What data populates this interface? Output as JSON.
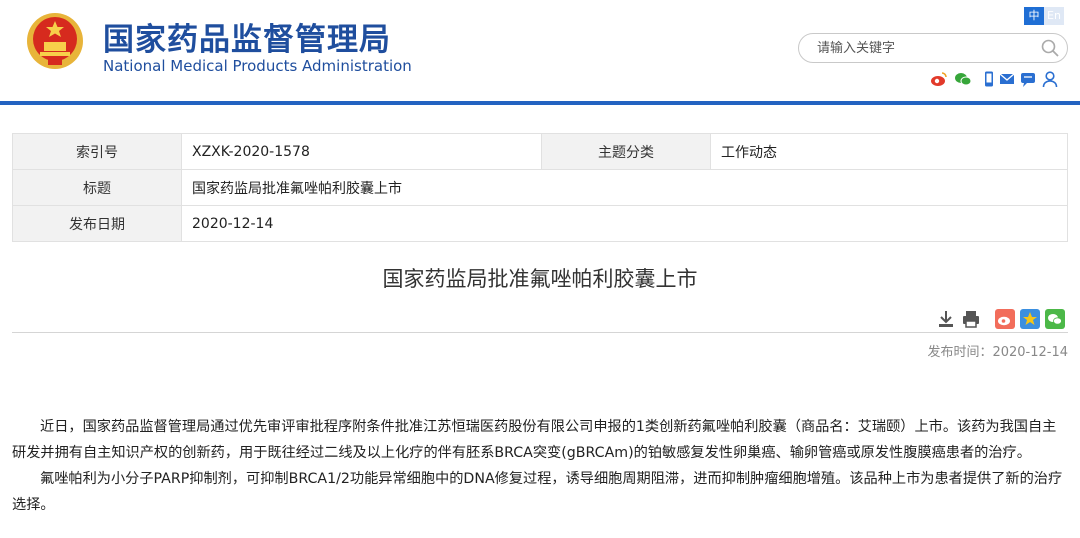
{
  "header": {
    "title_cn": "国家药品监督管理局",
    "title_en": "National Medical Products Administration",
    "lang_cn": "中",
    "lang_en": "En",
    "search_placeholder": "请输入关键字",
    "brand_color": "#1f4e9e",
    "accent_color": "#2363c1",
    "icons": [
      "weibo-icon",
      "wechat-icon",
      "mobile-icon",
      "mail-icon",
      "message-icon",
      "user-icon"
    ]
  },
  "meta": {
    "rows": [
      {
        "label1": "索引号",
        "value1": "XZXK-2020-1578",
        "label2": "主题分类",
        "value2": "工作动态"
      },
      {
        "label1": "标题",
        "value1": "国家药监局批准氟唑帕利胶囊上市"
      },
      {
        "label1": "发布日期",
        "value1": "2020-12-14"
      }
    ]
  },
  "article": {
    "title": "国家药监局批准氟唑帕利胶囊上市",
    "pubdate": "发布时间：2020-12-14",
    "tools": [
      "download-icon",
      "print-icon",
      "weibo-share-icon",
      "qzone-share-icon",
      "wechat-share-icon"
    ],
    "paragraphs": [
      "近日，国家药品监督管理局通过优先审评审批程序附条件批准江苏恒瑞医药股份有限公司申报的1类创新药氟唑帕利胶囊（商品名：艾瑞颐）上市。该药为我国自主研发并拥有自主知识产权的创新药，用于既往经过二线及以上化疗的伴有胚系BRCA突变(gBRCAm)的铂敏感复发性卵巢癌、输卵管癌或原发性腹膜癌患者的治疗。",
      "氟唑帕利为小分子PARP抑制剂，可抑制BRCA1/2功能异常细胞中的DNA修复过程，诱导细胞周期阻滞，进而抑制肿瘤细胞增殖。该品种上市为患者提供了新的治疗选择。"
    ]
  }
}
